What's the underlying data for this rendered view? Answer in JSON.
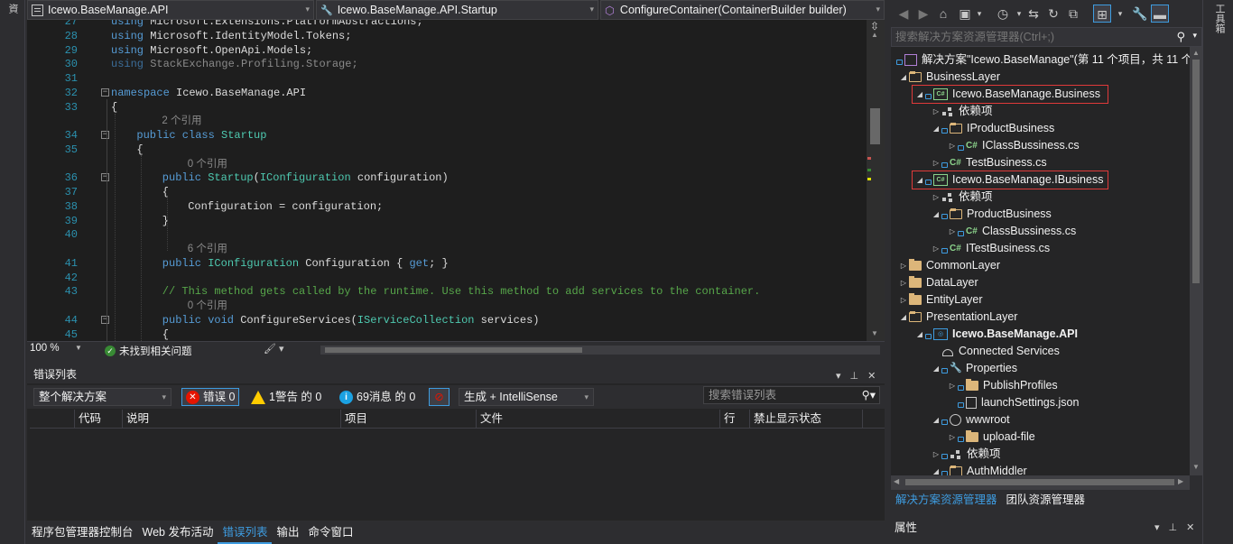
{
  "left_strip": {
    "label": "資"
  },
  "right_strip": {
    "label": "工具箱"
  },
  "nav": {
    "project_combo": "Icewo.BaseManage.API",
    "class_combo": "Icewo.BaseManage.API.Startup",
    "member_combo": "ConfigureContainer(ContainerBuilder builder)"
  },
  "editor": {
    "lines": [
      {
        "n": "27",
        "text": "using Microsoft.Extensions.PlatformAbstractions;",
        "kind": "using"
      },
      {
        "n": "28",
        "text": "using Microsoft.IdentityModel.Tokens;",
        "kind": "using"
      },
      {
        "n": "29",
        "text": "using Microsoft.OpenApi.Models;",
        "kind": "using"
      },
      {
        "n": "30",
        "text": "using StackExchange.Profiling.Storage;",
        "kind": "using-dim"
      },
      {
        "n": "31",
        "text": "",
        "kind": "blank"
      },
      {
        "n": "32",
        "text": "namespace Icewo.BaseManage.API",
        "kind": "ns"
      },
      {
        "n": "33",
        "text": "{",
        "kind": "plain"
      },
      {
        "ref": "2 个引用"
      },
      {
        "n": "34",
        "text": "public class Startup",
        "kind": "class"
      },
      {
        "n": "35",
        "text": "{",
        "kind": "plain"
      },
      {
        "ref": "0 个引用"
      },
      {
        "n": "36",
        "text": "public Startup(IConfiguration configuration)",
        "kind": "ctor"
      },
      {
        "n": "37",
        "text": "{",
        "kind": "plain"
      },
      {
        "n": "38",
        "text": "Configuration = configuration;",
        "kind": "assign"
      },
      {
        "n": "39",
        "text": "}",
        "kind": "plain"
      },
      {
        "n": "40",
        "text": "",
        "kind": "blank"
      },
      {
        "ref": "6 个引用"
      },
      {
        "n": "41",
        "text": "public IConfiguration Configuration { get; }",
        "kind": "prop"
      },
      {
        "n": "42",
        "text": "",
        "kind": "blank"
      },
      {
        "n": "43",
        "text": "// This method gets called by the runtime. Use this method to add services to the container.",
        "kind": "comment"
      },
      {
        "ref": "0 个引用"
      },
      {
        "n": "44",
        "text": "public void ConfigureServices(IServiceCollection services)",
        "kind": "method"
      },
      {
        "n": "45",
        "text": "{",
        "kind": "plain"
      }
    ]
  },
  "status": {
    "zoom": "100 %",
    "issues": "未找到相关问题"
  },
  "error_list": {
    "title": "错误列表",
    "scope": "整个解决方案",
    "errors": "错误 0",
    "warnings": "1警告 的 0",
    "messages": "69消息 的 0",
    "build_filter": "生成 + IntelliSense",
    "search_placeholder": "搜索错误列表",
    "columns": [
      "代码",
      "说明",
      "项目",
      "文件",
      "行",
      "禁止显示状态"
    ]
  },
  "bottom_tabs": [
    "程序包管理器控制台",
    "Web 发布活动",
    "错误列表",
    "输出",
    "命令窗口"
  ],
  "solution_explorer": {
    "search_placeholder": "搜索解决方案资源管理器(Ctrl+;)",
    "tree": [
      {
        "label": "解决方案\"Icewo.BaseManage\"(第 11 个项目，共 11 个)",
        "level": 0,
        "icon": "solution",
        "tri": "",
        "lock": true
      },
      {
        "label": "BusinessLayer",
        "level": 1,
        "icon": "folder-open",
        "tri": "open"
      },
      {
        "label": "Icewo.BaseManage.Business",
        "level": 2,
        "icon": "csproj",
        "tri": "open",
        "lock": true,
        "highlight": true
      },
      {
        "label": "依赖项",
        "level": 3,
        "icon": "dependencies",
        "tri": "closed"
      },
      {
        "label": "IProductBusiness",
        "level": 3,
        "icon": "folder-open",
        "tri": "open",
        "lock": true
      },
      {
        "label": "IClassBussiness.cs",
        "level": 4,
        "icon": "cs",
        "tri": "closed",
        "lock": true
      },
      {
        "label": "TestBusiness.cs",
        "level": 3,
        "icon": "cs",
        "tri": "closed",
        "lock": true
      },
      {
        "label": "Icewo.BaseManage.IBusiness",
        "level": 2,
        "icon": "csproj",
        "tri": "open",
        "lock": true,
        "highlight": true
      },
      {
        "label": "依赖项",
        "level": 3,
        "icon": "dependencies",
        "tri": "closed"
      },
      {
        "label": "ProductBusiness",
        "level": 3,
        "icon": "folder-open",
        "tri": "open",
        "lock": true
      },
      {
        "label": "ClassBussiness.cs",
        "level": 4,
        "icon": "cs",
        "tri": "closed",
        "lock": true
      },
      {
        "label": "ITestBusiness.cs",
        "level": 3,
        "icon": "cs",
        "tri": "closed",
        "lock": true
      },
      {
        "label": "CommonLayer",
        "level": 1,
        "icon": "folder",
        "tri": "closed"
      },
      {
        "label": "DataLayer",
        "level": 1,
        "icon": "folder",
        "tri": "closed"
      },
      {
        "label": "EntityLayer",
        "level": 1,
        "icon": "folder",
        "tri": "closed"
      },
      {
        "label": "PresentationLayer",
        "level": 1,
        "icon": "folder-open",
        "tri": "open"
      },
      {
        "label": "Icewo.BaseManage.API",
        "level": 2,
        "icon": "webproj",
        "tri": "open",
        "lock": true,
        "bold": true
      },
      {
        "label": "Connected Services",
        "level": 3,
        "icon": "connected",
        "tri": ""
      },
      {
        "label": "Properties",
        "level": 3,
        "icon": "wrench",
        "tri": "open",
        "lock": true
      },
      {
        "label": "PublishProfiles",
        "level": 4,
        "icon": "folder",
        "tri": "closed",
        "lock": true
      },
      {
        "label": "launchSettings.json",
        "level": 4,
        "icon": "json",
        "tri": "",
        "lock": true
      },
      {
        "label": "wwwroot",
        "level": 3,
        "icon": "globe",
        "tri": "open",
        "lock": true
      },
      {
        "label": "upload-file",
        "level": 4,
        "icon": "folder",
        "tri": "closed",
        "lock": true
      },
      {
        "label": "依赖项",
        "level": 3,
        "icon": "dependencies",
        "tri": "closed",
        "lock": true
      },
      {
        "label": "AuthMiddler",
        "level": 3,
        "icon": "folder-open",
        "tri": "open",
        "lock": true
      }
    ],
    "tabs": [
      "解决方案资源管理器",
      "团队资源管理器"
    ]
  },
  "properties": {
    "title": "属性"
  },
  "colors": {
    "accent": "#3e9ce0",
    "highlight_box": "#e03a3a",
    "keyword": "#569cd6",
    "type": "#4ec9b0",
    "comment": "#57a64a"
  }
}
